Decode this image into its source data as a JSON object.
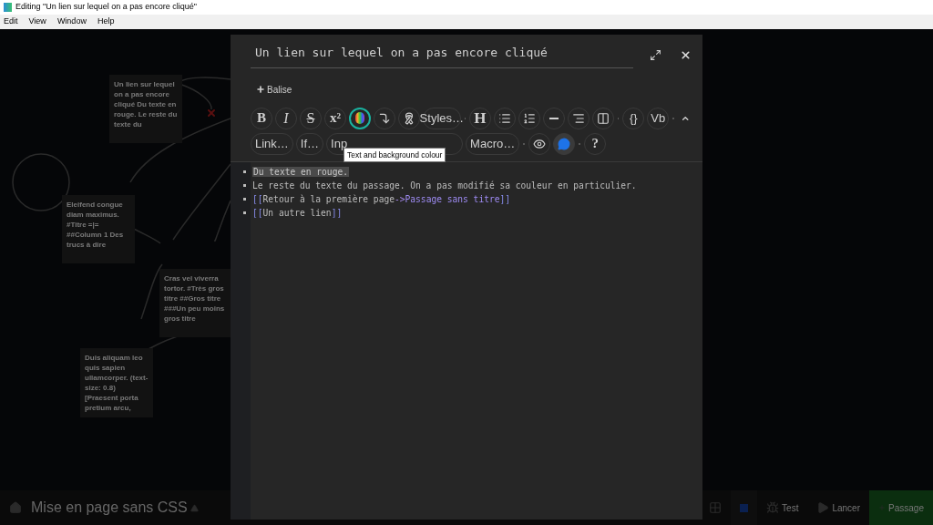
{
  "window": {
    "title": "Editing \"Un lien sur lequel on a pas encore cliqué\""
  },
  "menu": [
    "Edit",
    "View",
    "Window",
    "Help"
  ],
  "story_cards": [
    {
      "text": "Un lien sur lequel on a pas encore cliqué Du texte en rouge. Le reste du texte du"
    },
    {
      "text": "Eleifend congue diam maximus. #Titre =|= ##Column 1 Des trucs à dire"
    },
    {
      "text": "Cras vel viverra tortor. #Très gros titre ##Gros titre ###Un peu moins gros titre"
    },
    {
      "text": "Duis aliquam leo quis sapien ullamcorper. (text-size: 0.8)[Praesent porta pretium arcu,"
    }
  ],
  "bottom_bar": {
    "story_title": "Mise en page sans CSS",
    "buttons": [
      {
        "kind": "grid"
      },
      {
        "kind": "color"
      },
      {
        "kind": "test",
        "label": "Test"
      },
      {
        "kind": "play",
        "label": "Lancer"
      },
      {
        "kind": "add",
        "label": "Passage"
      }
    ]
  },
  "dialog": {
    "passage_name": "Un lien sur lequel on a pas encore cliqué",
    "tag_button": "Balise",
    "toolbar_rows": [
      [
        {
          "kind": "bold",
          "label": "B"
        },
        {
          "kind": "italic",
          "label": "I"
        },
        {
          "kind": "strike",
          "label": "S"
        },
        {
          "kind": "bold",
          "label": "x²"
        },
        {
          "kind": "colour",
          "focused": true
        },
        {
          "kind": "corner"
        },
        {
          "kind": "ribbon"
        },
        {
          "kind": "text",
          "label": "Styles…"
        },
        {
          "kind": "sep"
        },
        {
          "kind": "heading",
          "label": "H"
        },
        {
          "kind": "bullets"
        },
        {
          "kind": "numbers"
        },
        {
          "kind": "rule"
        },
        {
          "kind": "align"
        },
        {
          "kind": "columns"
        },
        {
          "kind": "sep"
        },
        {
          "kind": "text",
          "label": "{}"
        },
        {
          "kind": "text",
          "label": "Vb"
        },
        {
          "kind": "sep"
        }
      ],
      [
        {
          "kind": "text",
          "label": "Link…"
        },
        {
          "kind": "text",
          "label": "If…"
        },
        {
          "kind": "input",
          "label": "Inp"
        },
        {
          "kind": "text",
          "label": "Macro…"
        },
        {
          "kind": "sep"
        },
        {
          "kind": "eye"
        },
        {
          "kind": "comment",
          "active": true
        },
        {
          "kind": "sep"
        },
        {
          "kind": "bold",
          "label": "?"
        }
      ]
    ],
    "tooltip": "Text and background colour",
    "lines": [
      [
        {
          "kind": "highlight",
          "text": "Du texte en rouge."
        }
      ],
      [
        {
          "kind": "plain",
          "text": "Le reste du texte du passage. On a pas modifié sa couleur en particulier."
        }
      ],
      [
        {
          "kind": "bracket",
          "text": "[["
        },
        {
          "kind": "plain",
          "text": "Retour à la première page"
        },
        {
          "kind": "arrow",
          "text": "->"
        },
        {
          "kind": "target",
          "text": "Passage sans titre"
        },
        {
          "kind": "bracket",
          "text": "]]"
        }
      ],
      [
        {
          "kind": "bracket",
          "text": "[["
        },
        {
          "kind": "plain",
          "text": "Un autre lien"
        },
        {
          "kind": "bracket",
          "text": "]]"
        }
      ]
    ]
  }
}
